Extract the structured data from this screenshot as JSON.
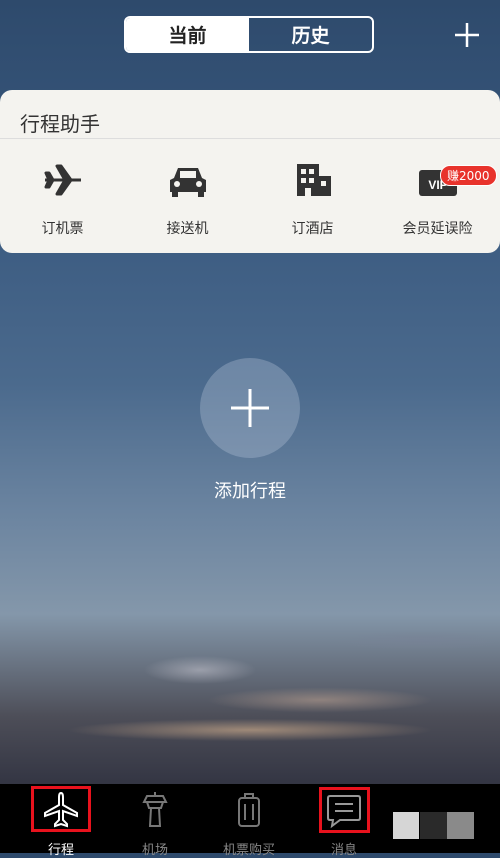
{
  "segment": {
    "current": "当前",
    "history": "历史"
  },
  "assistant": {
    "title": "行程助手",
    "items": [
      {
        "label": "订机票",
        "icon": "plane-icon"
      },
      {
        "label": "接送机",
        "icon": "car-icon"
      },
      {
        "label": "订酒店",
        "icon": "hotel-icon"
      },
      {
        "label": "会员延误险",
        "icon": "vip-card-icon",
        "badge": "赚2000",
        "card_text": "VIP"
      }
    ]
  },
  "main": {
    "add_trip": "添加行程"
  },
  "nav": {
    "items": [
      {
        "label": "行程",
        "icon": "plane-icon",
        "active": true
      },
      {
        "label": "机场",
        "icon": "airport-tower-icon",
        "active": false
      },
      {
        "label": "机票购买",
        "icon": "luggage-icon",
        "active": false
      },
      {
        "label": "消息",
        "icon": "message-icon",
        "active": false
      }
    ]
  },
  "colors": {
    "highlight": "#e8121d",
    "badge": "#e8332c",
    "card_bg": "#f4f3ef"
  }
}
